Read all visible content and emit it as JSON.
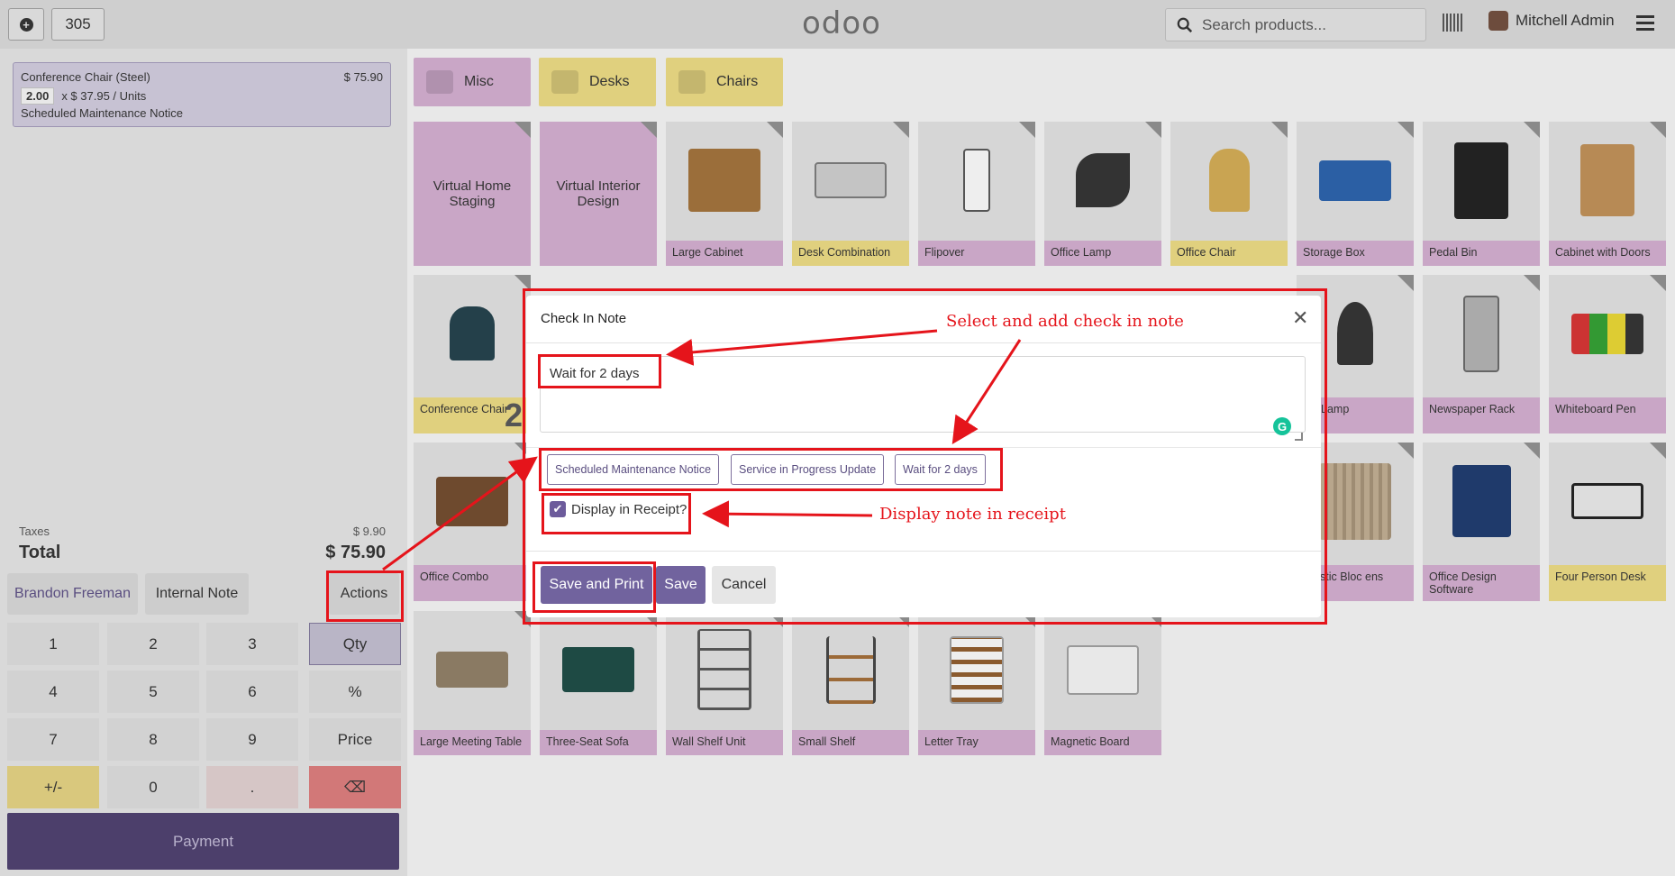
{
  "topbar": {
    "new_order_icon": "plus-circle-icon",
    "table_number": "305",
    "logo": "odoo",
    "search_placeholder": "Search products...",
    "user_name": "Mitchell Admin"
  },
  "order": {
    "line": {
      "name": "Conference Chair (Steel)",
      "price": "$ 75.90",
      "qty": "2.00",
      "unit_price": "x $ 37.95 / Units",
      "note": "Scheduled Maintenance Notice"
    },
    "taxes_label": "Taxes",
    "taxes_value": "$ 9.90",
    "total_label": "Total",
    "total_value": "$ 75.90"
  },
  "controls": {
    "customer": "Brandon Freeman",
    "internal_note": "Internal Note",
    "actions": "Actions"
  },
  "numpad": {
    "k1": "1",
    "k2": "2",
    "k3": "3",
    "qty": "Qty",
    "k4": "4",
    "k5": "5",
    "k6": "6",
    "pct": "%",
    "k7": "7",
    "k8": "8",
    "k9": "9",
    "price": "Price",
    "sign": "+/-",
    "k0": "0",
    "dot": ".",
    "backspace": "⌫",
    "payment": "Payment"
  },
  "categories": [
    {
      "label": "Misc",
      "color": "#c9a6c6"
    },
    {
      "label": "Desks",
      "color": "#e0d07e"
    },
    {
      "label": "Chairs",
      "color": "#e0d07e"
    }
  ],
  "products": {
    "row1": [
      "Virtual Home Staging",
      "Virtual Interior Design",
      "Large Cabinet",
      "Desk Combination",
      "Flipover",
      "Office Lamp",
      "Office Chair",
      "Storage Box",
      "Pedal Bin",
      "Cabinet with Doors"
    ],
    "row2": [
      "Conference Chair",
      "Lamp",
      "Newspaper Rack",
      "Whiteboard Pen"
    ],
    "row3": [
      "Office Combo",
      "stic Bloc ens",
      "Office Design Software",
      "Four Person Desk"
    ],
    "row4": [
      "Large Meeting Table",
      "Three-Seat Sofa",
      "Wall Shelf Unit",
      "Small Shelf",
      "Letter Tray",
      "Magnetic Board"
    ],
    "conference_qty": "2"
  },
  "modal": {
    "title": "Check In Note",
    "note_value": "Wait for 2 days",
    "presets": [
      "Scheduled Maintenance Notice",
      "Service in Progress Update",
      "Wait for 2 days"
    ],
    "display_in_receipt": "Display in Receipt?",
    "save_and_print": "Save and Print",
    "save": "Save",
    "cancel": "Cancel"
  },
  "annotations": {
    "select_note": "Select and add check in note",
    "display_note": "Display note in receipt"
  }
}
